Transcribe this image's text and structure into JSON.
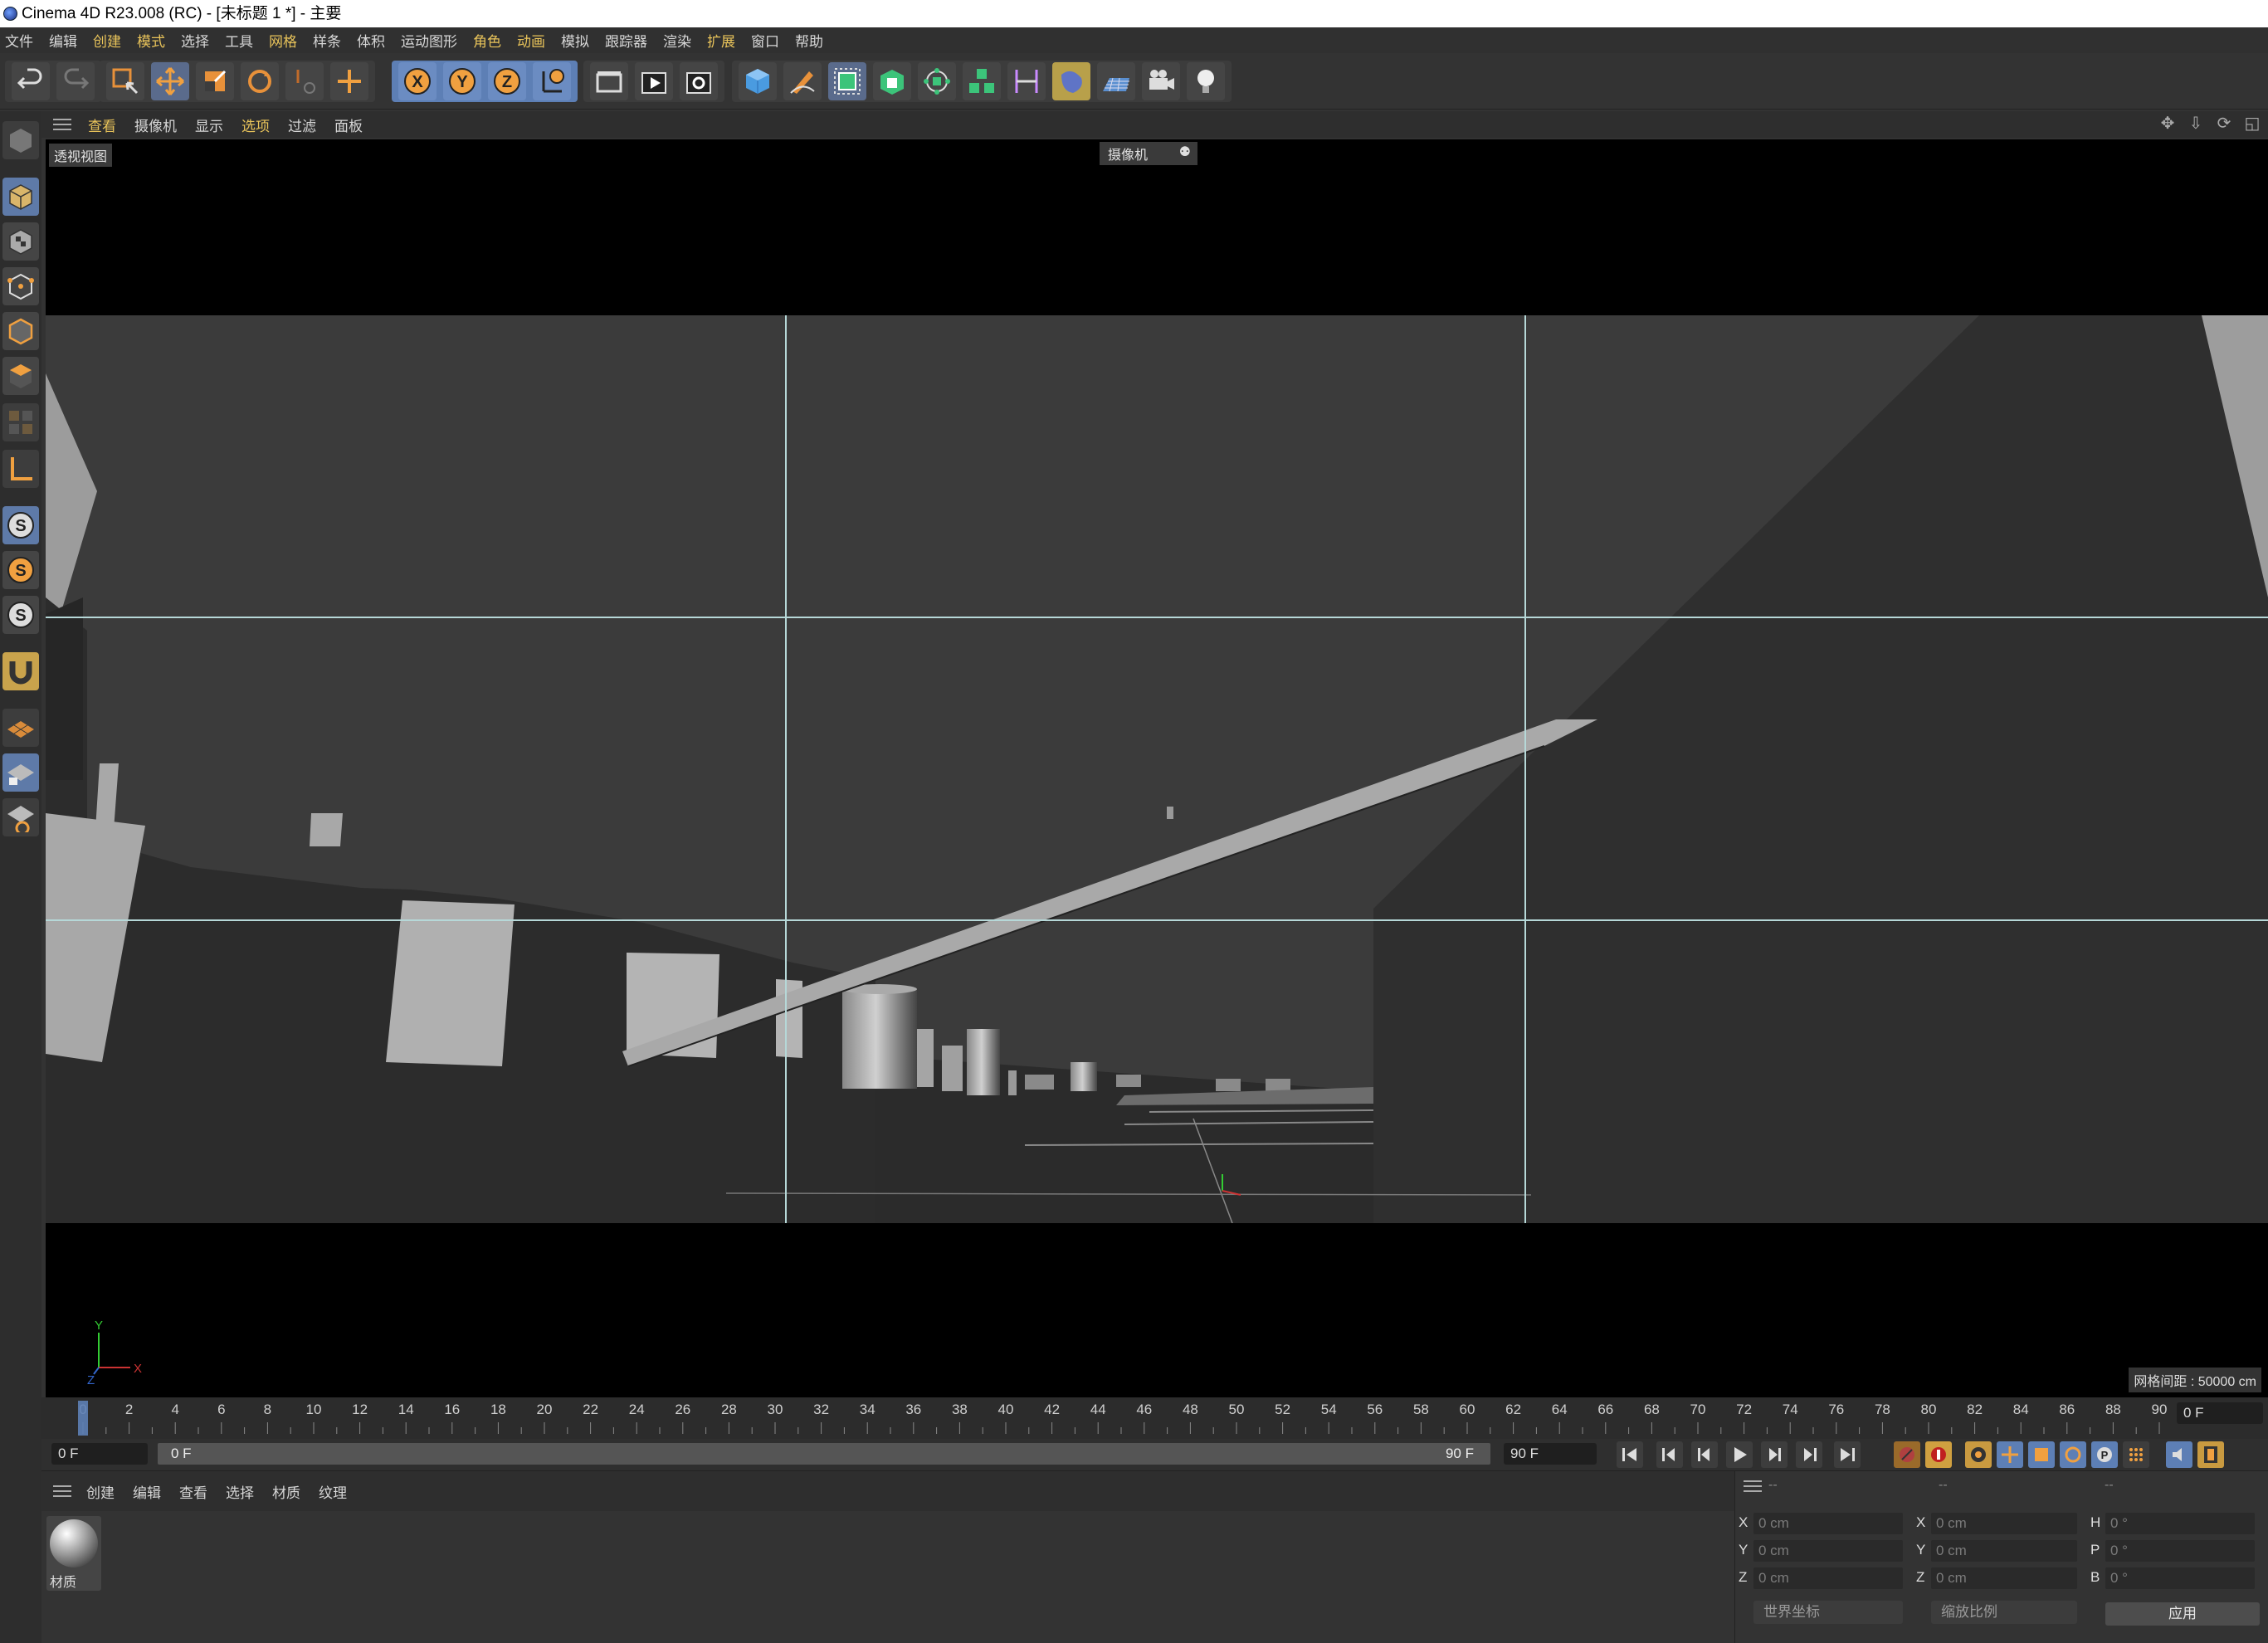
{
  "window": {
    "title": "Cinema 4D R23.008 (RC) - [未标题 1 *] - 主要"
  },
  "menubar": {
    "items": [
      {
        "label": "文件"
      },
      {
        "label": "编辑"
      },
      {
        "label": "创建"
      },
      {
        "label": "模式"
      },
      {
        "label": "选择"
      },
      {
        "label": "工具"
      },
      {
        "label": "网格"
      },
      {
        "label": "样条"
      },
      {
        "label": "体积"
      },
      {
        "label": "运动图形"
      },
      {
        "label": "角色"
      },
      {
        "label": "动画"
      },
      {
        "label": "模拟"
      },
      {
        "label": "跟踪器"
      },
      {
        "label": "渲染"
      },
      {
        "label": "扩展"
      },
      {
        "label": "窗口"
      },
      {
        "label": "帮助"
      }
    ]
  },
  "toolbar": {
    "axis_x": "X",
    "axis_y": "Y",
    "axis_z": "Z",
    "icons": [
      "undo-icon",
      "redo-icon",
      "select-icon",
      "move-icon",
      "scale-icon",
      "rotate-icon",
      "recent-tool-icon",
      "add-icon",
      "lock-x-icon",
      "lock-y-icon",
      "lock-z-icon",
      "coordinate-system-icon",
      "render-view-icon",
      "render-picture-viewer-icon",
      "render-settings-icon",
      "cube-icon",
      "pen-icon",
      "subdivision-icon",
      "extrude-icon",
      "array-icon",
      "cloner-icon",
      "deformer-icon",
      "field-icon",
      "environment-icon",
      "camera-icon",
      "light-icon"
    ]
  },
  "left_tools": {
    "icons": [
      "model-mode-icon",
      "texture-mode-icon",
      "point-mode-icon",
      "edge-mode-icon",
      "polygon-mode-icon",
      "uv-mode-icon",
      "axis-mode-icon",
      "snap-icon",
      "snap-settings-icon",
      "snap-solo-icon",
      "magnet-icon",
      "workplane-icon",
      "workplane-lock-icon",
      "workplane-align-icon"
    ]
  },
  "viewport": {
    "menu": [
      {
        "label": "查看"
      },
      {
        "label": "摄像机"
      },
      {
        "label": "显示"
      },
      {
        "label": "选项"
      },
      {
        "label": "过滤"
      },
      {
        "label": "面板"
      }
    ],
    "view_name": "透视视图",
    "camera_label": "摄像机",
    "grid_spacing": "网格间距 : 50000 cm",
    "axis": {
      "y": "Y",
      "x": "X",
      "z": "Z"
    }
  },
  "timeline": {
    "ticks": [
      "0",
      "2",
      "4",
      "6",
      "8",
      "10",
      "12",
      "14",
      "16",
      "18",
      "20",
      "22",
      "24",
      "26",
      "28",
      "30",
      "32",
      "34",
      "36",
      "38",
      "40",
      "42",
      "44",
      "46",
      "48",
      "50",
      "52",
      "54",
      "56",
      "58",
      "60",
      "62",
      "64",
      "66",
      "68",
      "70",
      "72",
      "74",
      "76",
      "78",
      "80",
      "82",
      "84",
      "86",
      "88",
      "90"
    ],
    "current_frame": "0 F"
  },
  "frame_controls": {
    "start": "0 F",
    "range_start": "0 F",
    "range_end": "90 F",
    "end": "90 F"
  },
  "material_manager": {
    "menu": [
      {
        "label": "创建"
      },
      {
        "label": "编辑"
      },
      {
        "label": "查看"
      },
      {
        "label": "选择"
      },
      {
        "label": "材质"
      },
      {
        "label": "纹理"
      }
    ],
    "materials": [
      {
        "name": "材质"
      }
    ]
  },
  "coordinates": {
    "header": [
      "--",
      "--",
      "--"
    ],
    "rows": [
      {
        "l1": "X",
        "v1": "0 cm",
        "l2": "X",
        "v2": "0 cm",
        "l3": "H",
        "v3": "0 °"
      },
      {
        "l1": "Y",
        "v1": "0 cm",
        "l2": "Y",
        "v2": "0 cm",
        "l3": "P",
        "v3": "0 °"
      },
      {
        "l1": "Z",
        "v1": "0 cm",
        "l2": "Z",
        "v2": "0 cm",
        "l3": "B",
        "v3": "0 °"
      }
    ],
    "mode_select": "世界坐标",
    "scale_select": "缩放比例",
    "apply": "应用"
  },
  "colors": {
    "accent": "#e8c35a",
    "blue_tool": "#5e7aa8",
    "gold_tool": "#c9a34c"
  }
}
